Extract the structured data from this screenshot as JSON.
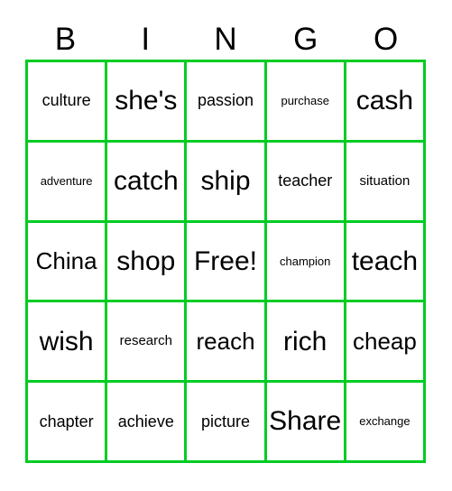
{
  "card": {
    "title": "BINGO",
    "border_color": "#00cc22",
    "text_color": "#000000",
    "background_color": "#ffffff",
    "header": {
      "letters": [
        "B",
        "I",
        "N",
        "G",
        "O"
      ]
    },
    "grid": {
      "columns": 5,
      "rows": 5,
      "free_space": "Free!",
      "free_space_position": {
        "row": 3,
        "column": 3
      },
      "cells": [
        [
          {
            "text": "culture",
            "size": "m"
          },
          {
            "text": "she's",
            "size": "xxl"
          },
          {
            "text": "passion",
            "size": "m"
          },
          {
            "text": "purchase",
            "size": "xs"
          },
          {
            "text": "cash",
            "size": "xxl"
          }
        ],
        [
          {
            "text": "adventure",
            "size": "xs"
          },
          {
            "text": "catch",
            "size": "xxl"
          },
          {
            "text": "ship",
            "size": "xxl"
          },
          {
            "text": "teacher",
            "size": "m"
          },
          {
            "text": "situation",
            "size": "s"
          }
        ],
        [
          {
            "text": "China",
            "size": "xl"
          },
          {
            "text": "shop",
            "size": "xxl"
          },
          {
            "text": "Free!",
            "size": "xxl"
          },
          {
            "text": "champion",
            "size": "xs"
          },
          {
            "text": "teach",
            "size": "xxl"
          }
        ],
        [
          {
            "text": "wish",
            "size": "xxl"
          },
          {
            "text": "research",
            "size": "s"
          },
          {
            "text": "reach",
            "size": "xl"
          },
          {
            "text": "rich",
            "size": "xxl"
          },
          {
            "text": "cheap",
            "size": "xl"
          }
        ],
        [
          {
            "text": "chapter",
            "size": "m"
          },
          {
            "text": "achieve",
            "size": "m"
          },
          {
            "text": "picture",
            "size": "m"
          },
          {
            "text": "Share",
            "size": "xxl"
          },
          {
            "text": "exchange",
            "size": "xs"
          }
        ]
      ]
    }
  }
}
